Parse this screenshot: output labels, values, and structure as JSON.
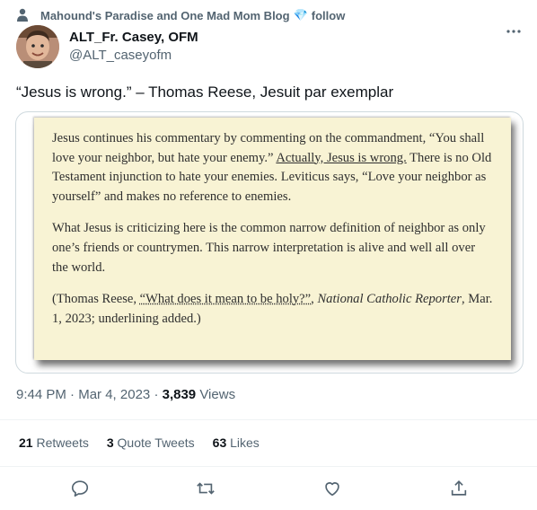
{
  "social_context": {
    "text_prefix": "Mahound's Paradise and One Mad Mom Blog",
    "emoji": "💎",
    "text_suffix": "follow",
    "icon": "person-icon"
  },
  "author": {
    "display_name": "ALT_Fr. Casey, OFM",
    "handle": "@ALT_caseyofm"
  },
  "tweet": {
    "text": "“Jesus is wrong.” – Thomas Reese, Jesuit par exemplar"
  },
  "scan": {
    "p1_a": "Jesus continues his commentary by commenting on the commandment, “You shall love your neighbor, but hate your enemy.” ",
    "p1_u": "Actually, Jesus is wrong.",
    "p1_b": " There is no Old Testament injunction to hate your enemies. Leviticus says, “Love your neighbor as yourself” and makes no reference to enemies.",
    "p2": "What Jesus is criticizing here is the common narrow definition of neighbor as only one’s friends or countrymen. This narrow interpretation is alive and well all over the world.",
    "p3_a": "(Thomas Reese, ",
    "p3_link": "“What does it mean to be holy?”",
    "p3_b": ", ",
    "p3_pub": "National Catholic Reporter",
    "p3_c": ", Mar. 1, 2023; underlining added.)"
  },
  "meta": {
    "time": "9:44 PM",
    "date": "Mar 4, 2023",
    "sep": "·",
    "views_count": "3,839",
    "views_label": "Views"
  },
  "stats": {
    "retweets_count": "21",
    "retweets_label": "Retweets",
    "quotes_count": "3",
    "quotes_label": "Quote Tweets",
    "likes_count": "63",
    "likes_label": "Likes"
  },
  "actions": [
    "reply-icon",
    "retweet-icon",
    "like-icon",
    "share-icon"
  ],
  "colors": {
    "muted": "#536471",
    "text": "#0f1419",
    "scan_bg": "#f8f3d4",
    "diamond": "#4da3ff"
  }
}
